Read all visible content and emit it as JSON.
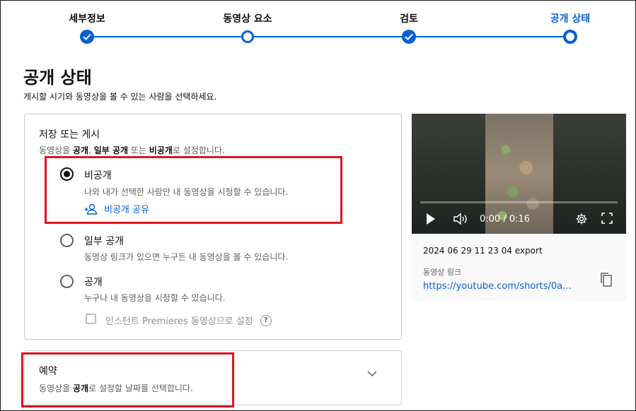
{
  "stepper": {
    "steps": [
      {
        "label": "세부정보",
        "state": "done"
      },
      {
        "label": "동영상 요소",
        "state": "pending"
      },
      {
        "label": "검토",
        "state": "done"
      },
      {
        "label": "공개 상태",
        "state": "current"
      }
    ]
  },
  "page": {
    "title": "공개 상태",
    "subtitle": "게시할 시기와 동영상을 볼 수 있는 사람을 선택하세요."
  },
  "save_publish": {
    "title": "저장 또는 게시",
    "desc_prefix": "동영상을 ",
    "desc_public": "공개",
    "desc_sep1": ", ",
    "desc_unlisted": "일부 공개",
    "desc_sep2": " 또는 ",
    "desc_private": "비공개",
    "desc_suffix": "로 설정합니다.",
    "options": [
      {
        "label": "비공개",
        "desc": "나와 내가 선택한 사람만 내 동영상을 시청할 수 있습니다.",
        "checked": true
      },
      {
        "label": "일부 공개",
        "desc": "동영상 링크가 있으면 누구든 내 동영상을 볼 수 있습니다.",
        "checked": false
      },
      {
        "label": "공개",
        "desc": "누구나 내 동영상을 시청할 수 있습니다.",
        "checked": false
      }
    ],
    "share_private_label": "비공개 공유",
    "premiere_label": "인스턴트 Premieres 동영상으로 설정",
    "help_glyph": "?"
  },
  "schedule": {
    "title": "예약",
    "desc_prefix": "동영상을 ",
    "desc_bold": "공개",
    "desc_suffix": "로 설정할 날짜를 선택합니다."
  },
  "preview": {
    "time": "0:00 / 0:16",
    "progress": 0,
    "file_name": "2024 06 29 11 23 04 export",
    "link_label": "동영상 링크",
    "link_url": "https://youtube.com/shorts/0a..."
  },
  "colors": {
    "accent": "#065fd4",
    "highlight": "#e0141e"
  }
}
